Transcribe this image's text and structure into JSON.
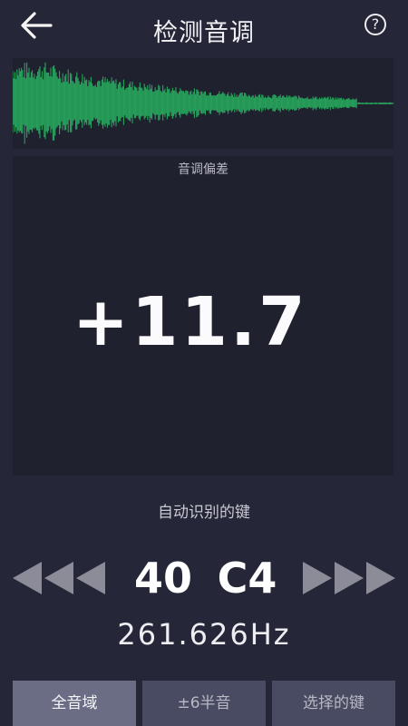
{
  "header": {
    "title": "检测音调",
    "help_symbol": "?"
  },
  "deviation": {
    "label": "音调偏差",
    "value": "+11.7"
  },
  "detection": {
    "label": "自动识别的键",
    "key_number": "40",
    "key_name": "C4",
    "frequency": "261.626Hz"
  },
  "tabs": [
    {
      "label": "全音域",
      "active": true
    },
    {
      "label": "±6半音",
      "active": false
    },
    {
      "label": "选择的键",
      "active": false
    }
  ],
  "colors": {
    "background": "#252638",
    "panel": "#20212f",
    "waveform": "#27a45c",
    "arrow": "#8b8c98",
    "tab_active": "#6b6d85",
    "tab": "#494b62"
  },
  "icons": {
    "back": "arrow-left-icon",
    "help": "question-circle-icon"
  }
}
